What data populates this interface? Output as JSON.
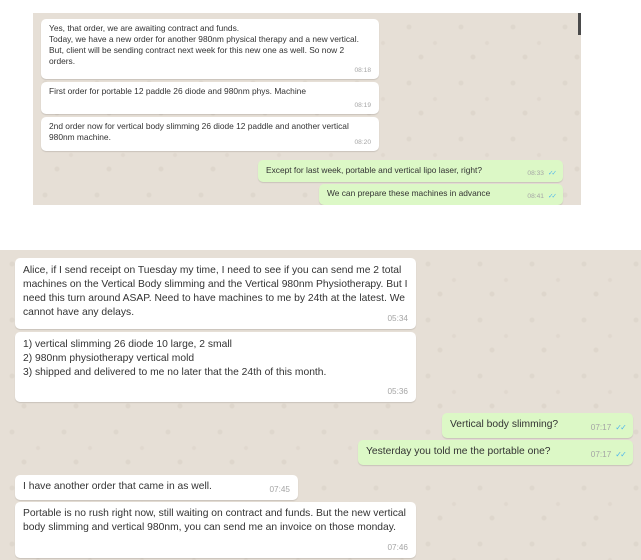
{
  "top_chat": {
    "messages": [
      {
        "dir": "in",
        "text": "Yes, that order, we are awaiting contract and funds.\nToday, we have a new order for another 980nm physical therapy and a new vertical.  But, client will be sending contract next week for this new one as well.  So now 2 orders.",
        "time": "08:18"
      },
      {
        "dir": "in",
        "text": "First order for portable 12 paddle 26 diode and 980nm phys. Machine",
        "time": "08:19"
      },
      {
        "dir": "in",
        "text": "2nd order now for vertical body slimming 26 diode 12 paddle and another vertical 980nm machine.",
        "time": "08:20"
      },
      {
        "dir": "out",
        "text": "Except for last week, portable and vertical lipo laser, right?",
        "time": "08:33",
        "status_icon": "double-check-read"
      },
      {
        "dir": "out",
        "text": "We can prepare these machines in advance",
        "time": "08:41",
        "status_icon": "double-check-read"
      }
    ]
  },
  "bottom_chat": {
    "messages": [
      {
        "dir": "in",
        "text": "Alice, if I send receipt on Tuesday my time, I need to see if you can send me 2 total machines on the Vertical Body slimming and the Vertical 980nm Physiotherapy. But I need this turn around ASAP.  Need to have machines to me by 24th at the latest.  We cannot have any delays.",
        "time": "05:34"
      },
      {
        "dir": "in",
        "text": "1)  vertical slimming 26 diode 10 large, 2 small\n2)  980nm physiotherapy vertical mold\n3) shipped and delivered to me no later that the 24th of this month.",
        "time": "05:36"
      },
      {
        "dir": "out",
        "text": "Vertical body slimming?",
        "time": "07:17",
        "status_icon": "double-check-read"
      },
      {
        "dir": "out",
        "text": "Yesterday you told me the portable one?",
        "time": "07:17",
        "status_icon": "double-check-read"
      },
      {
        "dir": "in",
        "text": "I have another order that came in as well.",
        "time": "07:45"
      },
      {
        "dir": "in",
        "text": "Portable is no rush right now, still waiting on contract and funds.  But the new vertical body slimming and vertical 980nm, you can send me an invoice on those monday.",
        "time": "07:46"
      }
    ]
  },
  "read_tick": "✓✓",
  "colors": {
    "incoming": "#ffffff",
    "outgoing": "#dcf8c6",
    "wallpaper": "#e6dfd6",
    "read_ticks": "#4fb6ec",
    "timestamp": "#a5a5a5"
  }
}
